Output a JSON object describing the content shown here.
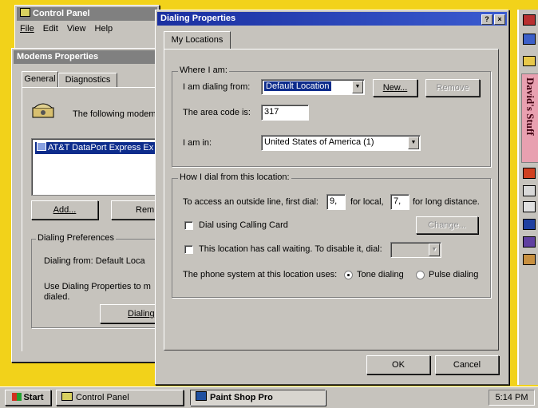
{
  "control_panel": {
    "title": "Control Panel",
    "menu": [
      "File",
      "Edit",
      "View",
      "Help"
    ]
  },
  "modems": {
    "title": "Modems Properties",
    "tabs": [
      "General",
      "Diagnostics"
    ],
    "intro": "The following modem",
    "modem_item": "AT&T DataPort Express Ex",
    "add_label": "Add...",
    "remove_label": "Rem",
    "prefs_group": "Dialing Preferences",
    "dialing_from": "Dialing from:   Default Loca",
    "use_text_1": "Use Dialing Properties to m",
    "use_text_2": "dialed.",
    "dialing_btn": "Dialing"
  },
  "dialing": {
    "title": "Dialing Properties",
    "help_btn": "?",
    "close_btn": "×",
    "tab": "My Locations",
    "where_group": "Where I am:",
    "dialing_from_label": "I am dialing from:",
    "dialing_from_value": "Default Location",
    "new_label": "New...",
    "remove_label": "Remove",
    "area_code_label": "The area code is:",
    "area_code_value": "317",
    "i_am_in_label": "I am in:",
    "country_value": "United States of America (1)",
    "how_group": "How I dial from this location:",
    "outside_line_label": "To access an outside line, first dial:",
    "local_value": "9,",
    "for_local": "for local,",
    "ld_value": "7,",
    "for_ld": "for long distance.",
    "calling_card_label": "Dial using Calling Card",
    "change_label": "Change...",
    "call_waiting_label": "This location has call waiting. To disable it, dial:",
    "phone_system_label": "The phone system at this location uses:",
    "tone_label": "Tone dialing",
    "pulse_label": "Pulse dialing",
    "ok_label": "OK",
    "cancel_label": "Cancel"
  },
  "side_panel": {
    "title": "David's Stuff"
  },
  "taskbar": {
    "start_label": "Start",
    "tasks": [
      "Control Panel",
      "Paint Shop Pro"
    ],
    "clock": "5:14 PM"
  }
}
